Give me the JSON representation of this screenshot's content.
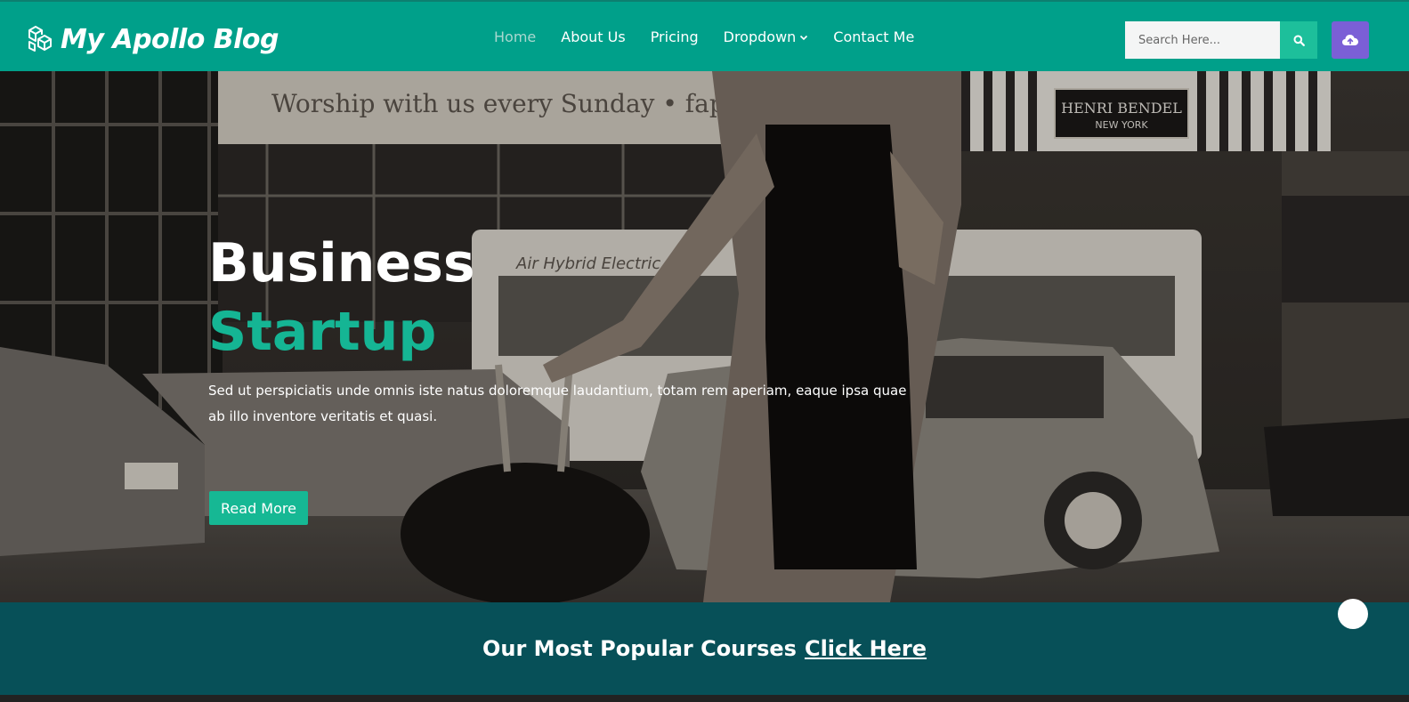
{
  "navbar": {
    "brand": "My Apollo Blog",
    "brand_icon": "cubes-logo-icon",
    "links": [
      {
        "label": "Home",
        "active": true
      },
      {
        "label": "About Us",
        "active": false
      },
      {
        "label": "Pricing",
        "active": false
      },
      {
        "label": "Dropdown",
        "active": false,
        "has_caret": true
      },
      {
        "label": "Contact Me",
        "active": false
      }
    ],
    "search": {
      "placeholder": "Search Here...",
      "value": "",
      "icon": "search-icon"
    },
    "cloud_button_icon": "cloud-upload-icon",
    "colors": {
      "background": "#00a08a",
      "search_button": "#1dbf9b",
      "cloud_button": "#7b5fd6"
    }
  },
  "hero": {
    "title_line_1": "Business",
    "title_line_2": "Startup",
    "text": "Sed ut perspiciatis unde omnis iste natus doloremque laudantium, totam rem aperiam, eaque ipsa quae ab illo inventore veritatis et quasi.",
    "button_label": "Read More",
    "colors": {
      "accent": "#15b594",
      "button": "#16b894"
    }
  },
  "cta": {
    "text": "Our Most Popular Courses",
    "link_label": "Click Here",
    "colors": {
      "background": "#075058"
    }
  },
  "scroll_top_icon": "scroll-top-dot"
}
